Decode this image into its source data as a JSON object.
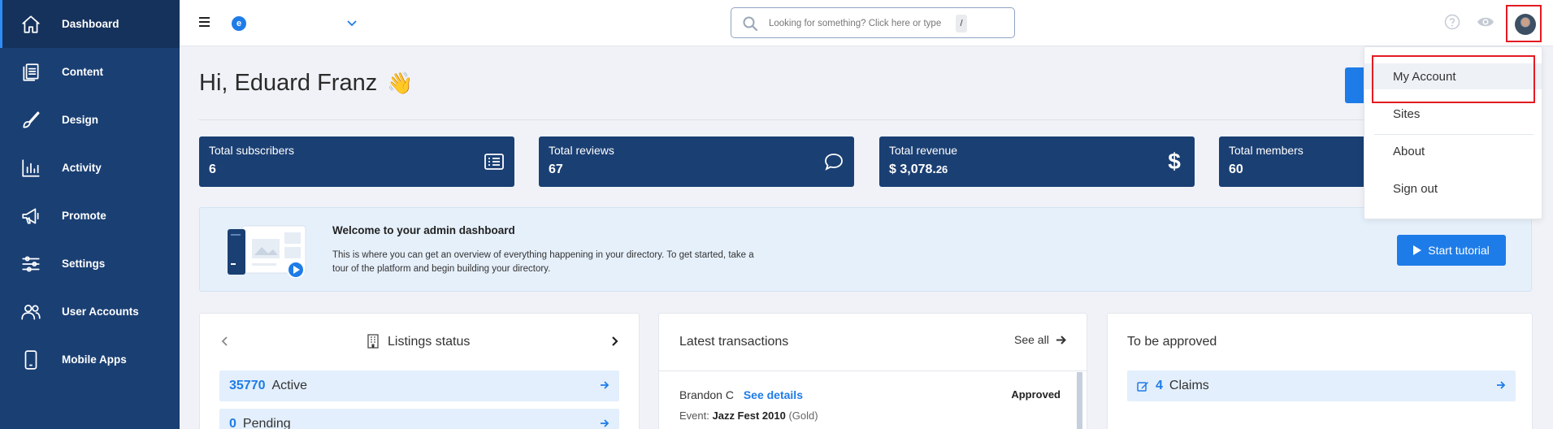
{
  "sidebar": {
    "items": [
      {
        "label": "Dashboard",
        "icon": "home-icon"
      },
      {
        "label": "Content",
        "icon": "documents-icon"
      },
      {
        "label": "Design",
        "icon": "brush-icon"
      },
      {
        "label": "Activity",
        "icon": "bar-chart-icon"
      },
      {
        "label": "Promote",
        "icon": "megaphone-icon"
      },
      {
        "label": "Settings",
        "icon": "sliders-icon"
      },
      {
        "label": "User Accounts",
        "icon": "users-icon"
      },
      {
        "label": "Mobile Apps",
        "icon": "phone-icon"
      }
    ]
  },
  "topbar": {
    "logo_letter": "e",
    "search_placeholder": "Looking for something? Click here or type",
    "search_shortcut": "/"
  },
  "greeting": {
    "text": "Hi, Eduard Franz",
    "emoji": "👋"
  },
  "stats": [
    {
      "label": "Total subscribers",
      "value": "6",
      "icon": "list-icon"
    },
    {
      "label": "Total reviews",
      "value": "67",
      "icon": "chat-bubble-icon"
    },
    {
      "label": "Total revenue",
      "value": "$ 3,078.",
      "value_cents": "26",
      "icon": "dollar-icon"
    },
    {
      "label": "Total members",
      "value": "60",
      "icon": "member-icon"
    }
  ],
  "welcome": {
    "title": "Welcome to your admin dashboard",
    "text": "This is where you can get an overview of everything happening in your directory. To get started, take a tour of the platform and begin building your directory.",
    "button": "Start tutorial"
  },
  "listings": {
    "title": "Listings status",
    "rows": [
      {
        "count": "35770",
        "label": "Active"
      },
      {
        "count": "0",
        "label": "Pending"
      }
    ]
  },
  "transactions": {
    "title": "Latest transactions",
    "see_all": "See all",
    "items": [
      {
        "name": "Brandon C",
        "link": "See details",
        "status": "Approved",
        "event_label": "Event:",
        "event": "Jazz Fest 2010",
        "tier": "(Gold)"
      }
    ]
  },
  "approval": {
    "title": "To be approved",
    "rows": [
      {
        "count": "4",
        "label": "Claims"
      }
    ]
  },
  "account_menu": {
    "items": [
      "My Account",
      "Sites",
      "About",
      "Sign out"
    ]
  },
  "colors": {
    "sidebar_bg": "#1a3f73",
    "accent": "#1e7ce8",
    "highlight_box": "#e31b23"
  }
}
